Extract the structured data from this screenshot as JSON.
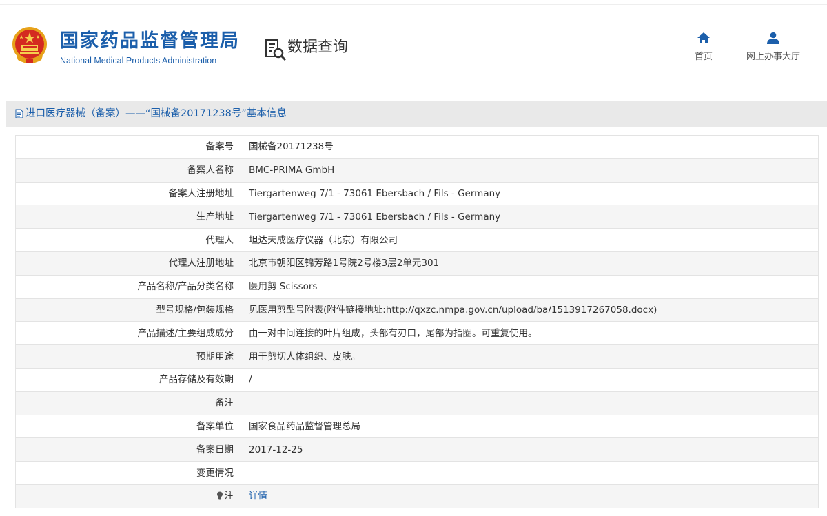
{
  "header": {
    "org_name_cn": "国家药品监督管理局",
    "org_name_en": "National Medical Products Administration",
    "section_title": "数据查询",
    "nav": [
      {
        "label": "首页",
        "icon": "home-icon"
      },
      {
        "label": "网上办事大厅",
        "icon": "user-icon"
      }
    ]
  },
  "page": {
    "title": "进口医疗器械（备案）——“国械备20171238号”基本信息"
  },
  "colors": {
    "brand_blue": "#1c5fab",
    "titlebar_bg": "#e9e9e9",
    "row_alt_bg": "#f5f5f5"
  },
  "record": {
    "rows": [
      {
        "label": "备案号",
        "value": "国械备20171238号"
      },
      {
        "label": "备案人名称",
        "value": "BMC-PRIMA GmbH"
      },
      {
        "label": "备案人注册地址",
        "value": "Tiergartenweg 7/1 - 73061 Ebersbach / Fils - Germany"
      },
      {
        "label": "生产地址",
        "value": "Tiergartenweg 7/1 - 73061 Ebersbach / Fils - Germany"
      },
      {
        "label": "代理人",
        "value": "坦达天成医疗仪器（北京）有限公司"
      },
      {
        "label": "代理人注册地址",
        "value": "北京市朝阳区锦芳路1号院2号楼3层2单元301"
      },
      {
        "label": "产品名称/产品分类名称",
        "value": "医用剪 Scissors"
      },
      {
        "label": "型号规格/包装规格",
        "value": "见医用剪型号附表(附件链接地址:http://qxzc.nmpa.gov.cn/upload/ba/1513917267058.docx)"
      },
      {
        "label": "产品描述/主要组成成分",
        "value": "由一对中间连接的叶片组成，头部有刃口，尾部为指圈。可重复使用。"
      },
      {
        "label": "预期用途",
        "value": "用于剪切人体组织、皮肤。"
      },
      {
        "label": "产品存储及有效期",
        "value": "/"
      },
      {
        "label": "备注",
        "value": ""
      },
      {
        "label": "备案单位",
        "value": "国家食品药品监督管理总局"
      },
      {
        "label": "备案日期",
        "value": "2017-12-25"
      },
      {
        "label": "变更情况",
        "value": ""
      }
    ],
    "note_label": "注",
    "note_link": "详情"
  }
}
